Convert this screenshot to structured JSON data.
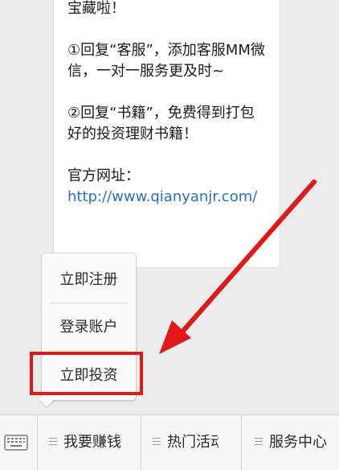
{
  "message": {
    "line0": "宝藏啦！",
    "para1": "①回复“客服”，添加客服MM微信，一对一服务更及时~",
    "para2": "②回复“书籍”，免费得到打包好的投资理财书籍！",
    "website_label": "官方网址：",
    "website_url": "http://www.qianyanjr.com/"
  },
  "popup_menu": {
    "items": [
      {
        "label": "立即注册"
      },
      {
        "label": "登录账户"
      },
      {
        "label": "立即投资"
      }
    ],
    "highlighted_index": 2
  },
  "bottom_bar": {
    "keyboard_icon": "keyboard-icon",
    "tabs": [
      {
        "label": "我要赚钱"
      },
      {
        "label": "热门活动"
      },
      {
        "label": "服务中心"
      }
    ]
  },
  "annotation": {
    "color": "#e01818"
  }
}
